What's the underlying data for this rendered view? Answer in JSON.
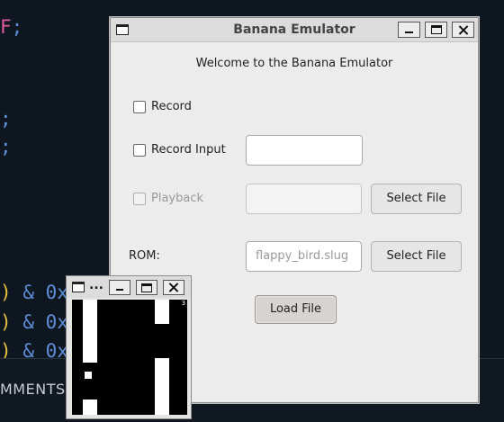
{
  "background_editor": {
    "line1_keyword": "F",
    "line1_semicolon": ";",
    "semicolon_a": ";",
    "semicolon_b": ";",
    "row_text": "& 0x",
    "paren": ")",
    "comments_label": "MMENTS"
  },
  "main_window": {
    "title": "Banana Emulator",
    "welcome_text": "Welcome to the Banana Emulator",
    "record": {
      "label": "Record",
      "checked": false
    },
    "record_input": {
      "label": "Record Input",
      "checked": false,
      "value": ""
    },
    "playback": {
      "label": "Playback",
      "checked": false,
      "enabled": false,
      "value": ""
    },
    "select_file_label": "Select File",
    "rom": {
      "label": "ROM:",
      "placeholder": "flappy_bird.slug",
      "select_label": "Select File"
    },
    "load_button_label": "Load File"
  },
  "game_window": {
    "title": "...",
    "score": "3"
  },
  "colors": {
    "editor_bg": "#0e1620",
    "keyword_pink": "#e05aa0",
    "code_blue": "#5d8fd8",
    "paren_yellow": "#e6c03c",
    "window_bg": "#ececec"
  }
}
